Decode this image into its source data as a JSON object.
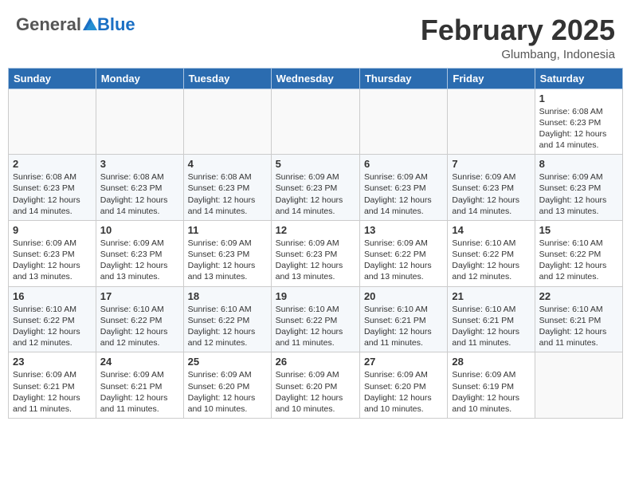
{
  "header": {
    "logo_general": "General",
    "logo_blue": "Blue",
    "month": "February 2025",
    "location": "Glumbang, Indonesia"
  },
  "weekdays": [
    "Sunday",
    "Monday",
    "Tuesday",
    "Wednesday",
    "Thursday",
    "Friday",
    "Saturday"
  ],
  "weeks": [
    [
      {
        "day": "",
        "info": ""
      },
      {
        "day": "",
        "info": ""
      },
      {
        "day": "",
        "info": ""
      },
      {
        "day": "",
        "info": ""
      },
      {
        "day": "",
        "info": ""
      },
      {
        "day": "",
        "info": ""
      },
      {
        "day": "1",
        "info": "Sunrise: 6:08 AM\nSunset: 6:23 PM\nDaylight: 12 hours\nand 14 minutes."
      }
    ],
    [
      {
        "day": "2",
        "info": "Sunrise: 6:08 AM\nSunset: 6:23 PM\nDaylight: 12 hours\nand 14 minutes."
      },
      {
        "day": "3",
        "info": "Sunrise: 6:08 AM\nSunset: 6:23 PM\nDaylight: 12 hours\nand 14 minutes."
      },
      {
        "day": "4",
        "info": "Sunrise: 6:08 AM\nSunset: 6:23 PM\nDaylight: 12 hours\nand 14 minutes."
      },
      {
        "day": "5",
        "info": "Sunrise: 6:09 AM\nSunset: 6:23 PM\nDaylight: 12 hours\nand 14 minutes."
      },
      {
        "day": "6",
        "info": "Sunrise: 6:09 AM\nSunset: 6:23 PM\nDaylight: 12 hours\nand 14 minutes."
      },
      {
        "day": "7",
        "info": "Sunrise: 6:09 AM\nSunset: 6:23 PM\nDaylight: 12 hours\nand 14 minutes."
      },
      {
        "day": "8",
        "info": "Sunrise: 6:09 AM\nSunset: 6:23 PM\nDaylight: 12 hours\nand 13 minutes."
      }
    ],
    [
      {
        "day": "9",
        "info": "Sunrise: 6:09 AM\nSunset: 6:23 PM\nDaylight: 12 hours\nand 13 minutes."
      },
      {
        "day": "10",
        "info": "Sunrise: 6:09 AM\nSunset: 6:23 PM\nDaylight: 12 hours\nand 13 minutes."
      },
      {
        "day": "11",
        "info": "Sunrise: 6:09 AM\nSunset: 6:23 PM\nDaylight: 12 hours\nand 13 minutes."
      },
      {
        "day": "12",
        "info": "Sunrise: 6:09 AM\nSunset: 6:23 PM\nDaylight: 12 hours\nand 13 minutes."
      },
      {
        "day": "13",
        "info": "Sunrise: 6:09 AM\nSunset: 6:22 PM\nDaylight: 12 hours\nand 13 minutes."
      },
      {
        "day": "14",
        "info": "Sunrise: 6:10 AM\nSunset: 6:22 PM\nDaylight: 12 hours\nand 12 minutes."
      },
      {
        "day": "15",
        "info": "Sunrise: 6:10 AM\nSunset: 6:22 PM\nDaylight: 12 hours\nand 12 minutes."
      }
    ],
    [
      {
        "day": "16",
        "info": "Sunrise: 6:10 AM\nSunset: 6:22 PM\nDaylight: 12 hours\nand 12 minutes."
      },
      {
        "day": "17",
        "info": "Sunrise: 6:10 AM\nSunset: 6:22 PM\nDaylight: 12 hours\nand 12 minutes."
      },
      {
        "day": "18",
        "info": "Sunrise: 6:10 AM\nSunset: 6:22 PM\nDaylight: 12 hours\nand 12 minutes."
      },
      {
        "day": "19",
        "info": "Sunrise: 6:10 AM\nSunset: 6:22 PM\nDaylight: 12 hours\nand 11 minutes."
      },
      {
        "day": "20",
        "info": "Sunrise: 6:10 AM\nSunset: 6:21 PM\nDaylight: 12 hours\nand 11 minutes."
      },
      {
        "day": "21",
        "info": "Sunrise: 6:10 AM\nSunset: 6:21 PM\nDaylight: 12 hours\nand 11 minutes."
      },
      {
        "day": "22",
        "info": "Sunrise: 6:10 AM\nSunset: 6:21 PM\nDaylight: 12 hours\nand 11 minutes."
      }
    ],
    [
      {
        "day": "23",
        "info": "Sunrise: 6:09 AM\nSunset: 6:21 PM\nDaylight: 12 hours\nand 11 minutes."
      },
      {
        "day": "24",
        "info": "Sunrise: 6:09 AM\nSunset: 6:21 PM\nDaylight: 12 hours\nand 11 minutes."
      },
      {
        "day": "25",
        "info": "Sunrise: 6:09 AM\nSunset: 6:20 PM\nDaylight: 12 hours\nand 10 minutes."
      },
      {
        "day": "26",
        "info": "Sunrise: 6:09 AM\nSunset: 6:20 PM\nDaylight: 12 hours\nand 10 minutes."
      },
      {
        "day": "27",
        "info": "Sunrise: 6:09 AM\nSunset: 6:20 PM\nDaylight: 12 hours\nand 10 minutes."
      },
      {
        "day": "28",
        "info": "Sunrise: 6:09 AM\nSunset: 6:19 PM\nDaylight: 12 hours\nand 10 minutes."
      },
      {
        "day": "",
        "info": ""
      }
    ]
  ]
}
